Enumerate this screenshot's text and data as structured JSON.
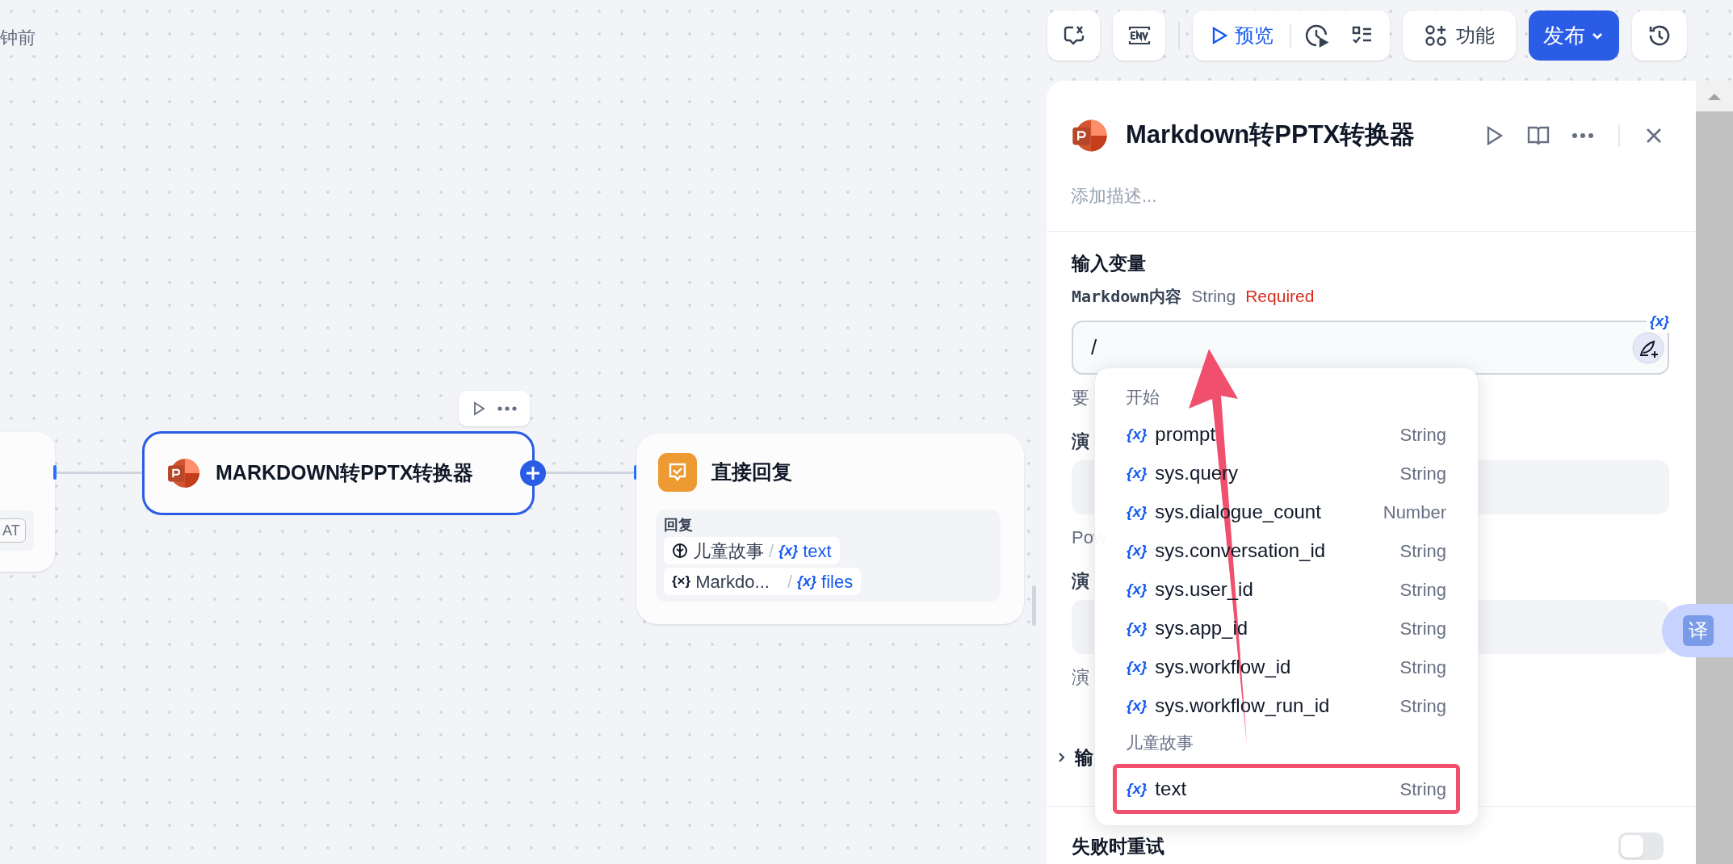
{
  "header": {
    "time_ago": "钟前"
  },
  "toolbar": {
    "preview": "预览",
    "features": "功能",
    "publish": "发布"
  },
  "canvas": {
    "left_node": {
      "chip": "AT"
    },
    "converter_node": {
      "title": "MARKDOWN转PPTX转换器",
      "selected": true
    },
    "answer_node": {
      "title": "直接回复",
      "section": "回复",
      "refs": [
        {
          "kind": "node",
          "node": "儿童故事",
          "sep": "/",
          "var_icon": "{x}",
          "var": "text"
        },
        {
          "kind": "variable",
          "node_icon": "{×}",
          "node": "Markdo...",
          "sep": "/",
          "var_icon": "{x}",
          "var": "files"
        }
      ]
    }
  },
  "panel": {
    "title": "Markdown转PPTX转换器",
    "description_placeholder": "添加描述...",
    "section": "输入变量",
    "field": {
      "name": "Markdown内容",
      "type": "String",
      "required": "Required",
      "value": "/",
      "var_badge": "{x}"
    },
    "hidden_fragments": [
      {
        "kind": "text",
        "text": "要"
      },
      {
        "kind": "label",
        "text": "演"
      },
      {
        "kind": "box"
      },
      {
        "kind": "text",
        "text": "Pow"
      },
      {
        "kind": "label",
        "text": "演"
      },
      {
        "kind": "box"
      },
      {
        "kind": "text",
        "text": "演"
      }
    ],
    "output_section": {
      "label": "输",
      "expanded": false
    },
    "retry": {
      "label": "失败时重试",
      "on": false
    }
  },
  "dropdown": {
    "groups": [
      {
        "title": "开始",
        "items": [
          {
            "icon": "{x}",
            "name": "prompt",
            "type": "String",
            "highlighted": false
          },
          {
            "icon": "{x}",
            "name": "sys.query",
            "type": "String",
            "highlighted": false
          },
          {
            "icon": "{x}",
            "name": "sys.dialogue_count",
            "type": "Number",
            "highlighted": false
          },
          {
            "icon": "{x}",
            "name": "sys.conversation_id",
            "type": "String",
            "highlighted": false
          },
          {
            "icon": "{x}",
            "name": "sys.user_id",
            "type": "String",
            "highlighted": false
          },
          {
            "icon": "{x}",
            "name": "sys.app_id",
            "type": "String",
            "highlighted": false
          },
          {
            "icon": "{x}",
            "name": "sys.workflow_id",
            "type": "String",
            "highlighted": false
          },
          {
            "icon": "{x}",
            "name": "sys.workflow_run_id",
            "type": "String",
            "highlighted": false
          }
        ]
      },
      {
        "title": "儿童故事",
        "items": [
          {
            "icon": "{x}",
            "name": "text",
            "type": "String",
            "highlighted": true
          }
        ]
      }
    ]
  },
  "translate_button": "译"
}
